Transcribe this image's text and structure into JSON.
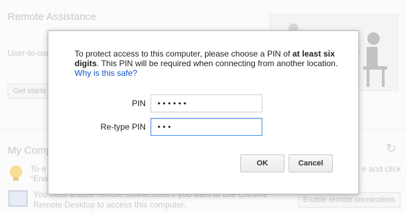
{
  "background": {
    "title": "Remote Assistance",
    "desc_fragment": "User-to-use",
    "get_started": "Get starte",
    "section_title": "My Comp",
    "tip_line1": "To e",
    "tip_line2": "“Ena",
    "tip_right": "e and click",
    "enable_note_line1": "You must enable remote connections if you want to use Chrome",
    "enable_note_line2": "Remote Desktop to access this computer.",
    "enable_button": "Enable remote connections"
  },
  "dialog": {
    "message_pre": "To protect access to this computer, please choose a PIN of ",
    "message_bold": "at least six digits",
    "message_post": ". This PIN will be required when connecting from another location.",
    "why_link": "Why is this safe?",
    "pin_label": "PIN",
    "pin_value": "••••••",
    "retype_label": "Re-type PIN",
    "retype_value": "•••",
    "ok_label": "OK",
    "cancel_label": "Cancel"
  },
  "icons": [
    "lightbulb-icon",
    "monitor-icon",
    "refresh-icon",
    "illustration-person"
  ]
}
